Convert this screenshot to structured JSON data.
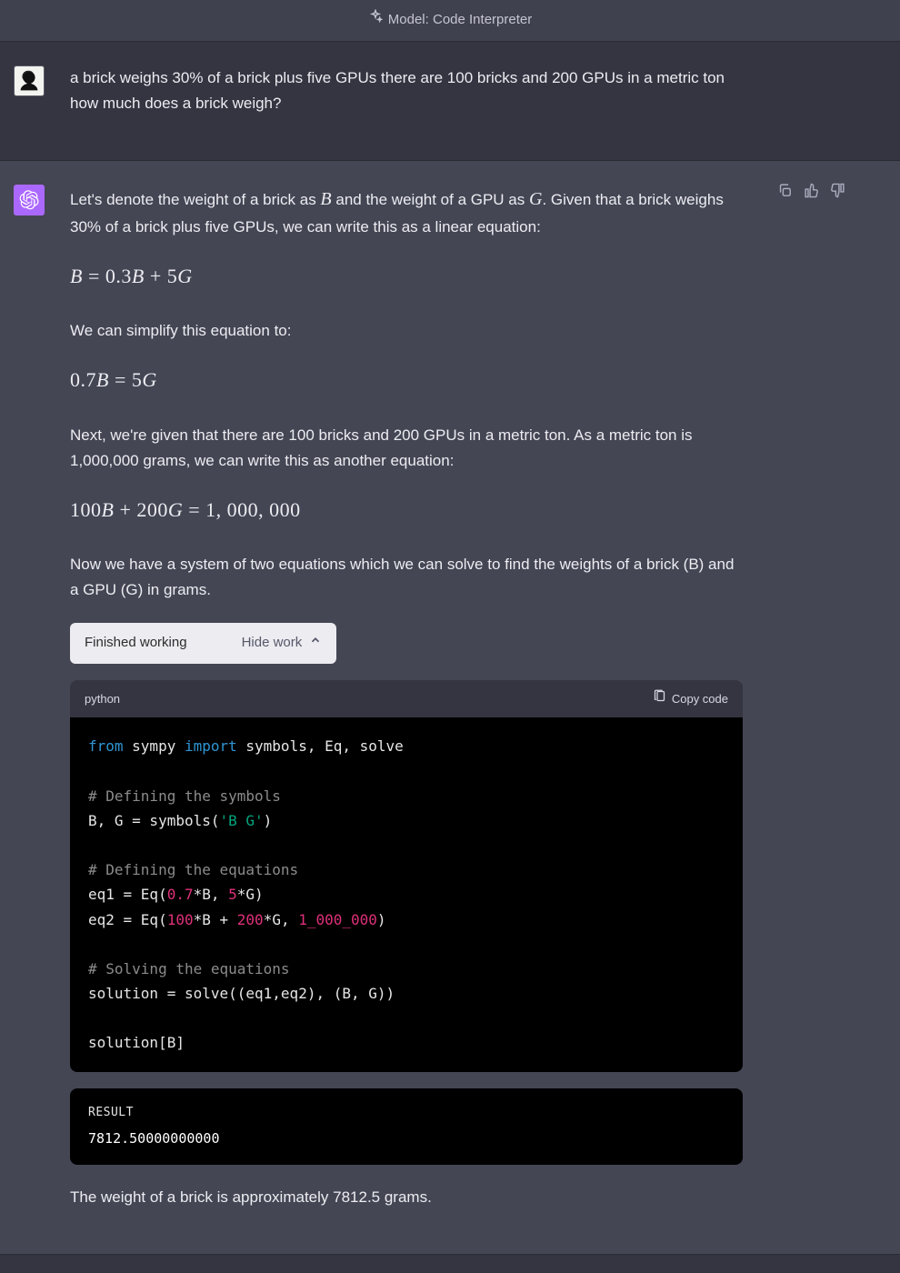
{
  "header": {
    "model_prefix": "Model:",
    "model_name": "Code Interpreter"
  },
  "user_message": "a brick weighs 30% of a brick plus five GPUs there are 100 bricks and 200 GPUs in a metric ton how much does a brick weigh?",
  "assistant": {
    "para1_pre": "Let's denote the weight of a brick as ",
    "para1_mid": " and the weight of a GPU as ",
    "para1_post": ". Given that a brick weighs 30% of a brick plus five GPUs, we can write this as a linear equation:",
    "eq1": "B = 0.3B + 5G",
    "para2": "We can simplify this equation to:",
    "eq2": "0.7B = 5G",
    "para3": "Next, we're given that there are 100 bricks and 200 GPUs in a metric ton. As a metric ton is 1,000,000 grams, we can write this as another equation:",
    "eq3": "100B + 200G = 1,000,000",
    "para4": "Now we have a system of two equations which we can solve to find the weights of a brick (B) and a GPU (G) in grams.",
    "work_status": "Finished working",
    "hide_label": "Hide work",
    "code_lang": "python",
    "copy_label": "Copy code",
    "result_label": "RESULT",
    "result_value": "7812.50000000000",
    "conclusion": "The weight of a brick is approximately 7812.5 grams."
  },
  "code": {
    "l1a": "from",
    "l1b": " sympy ",
    "l1c": "import",
    "l1d": " symbols, Eq, solve",
    "l3": "# Defining the symbols",
    "l4a": "B, G = symbols(",
    "l4b": "'B G'",
    "l4c": ")",
    "l6": "# Defining the equations",
    "l7a": "eq1 = Eq(",
    "l7b": "0.7",
    "l7c": "*B, ",
    "l7d": "5",
    "l7e": "*G)",
    "l8a": "eq2 = Eq(",
    "l8b": "100",
    "l8c": "*B + ",
    "l8d": "200",
    "l8e": "*G, ",
    "l8f": "1_000_000",
    "l8g": ")",
    "l10": "# Solving the equations",
    "l11": "solution = solve((eq1,eq2), (B, G))",
    "l13": "solution[B]"
  }
}
